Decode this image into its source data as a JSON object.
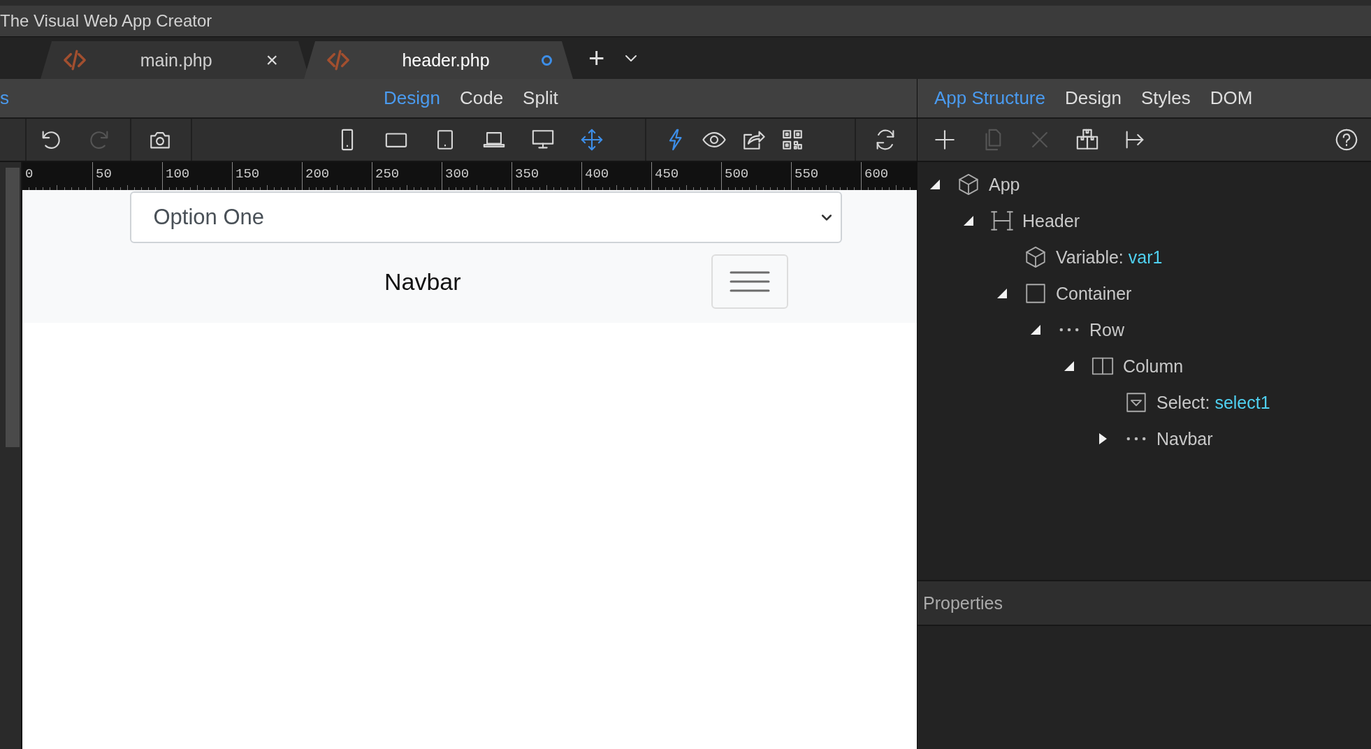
{
  "window": {
    "title": "The Visual Web App Creator"
  },
  "tabs": [
    {
      "label": "main.php",
      "selected": false,
      "close": "×",
      "modified": false
    },
    {
      "label": "header.php",
      "selected": true,
      "modified": true
    }
  ],
  "tab_actions": {
    "add": "+"
  },
  "left_fragment": "s",
  "view_modes": [
    {
      "label": "Design",
      "selected": true
    },
    {
      "label": "Code",
      "selected": false
    },
    {
      "label": "Split",
      "selected": false
    }
  ],
  "panel_tabs": [
    {
      "label": "App Structure",
      "selected": true
    },
    {
      "label": "Design",
      "selected": false
    },
    {
      "label": "Styles",
      "selected": false
    },
    {
      "label": "DOM",
      "selected": false
    }
  ],
  "toolbar": [
    {
      "group": [
        {
          "kind": "undo",
          "disabled": false
        },
        {
          "kind": "redo",
          "disabled": true
        }
      ]
    },
    {
      "group": [
        {
          "kind": "camera",
          "disabled": false
        }
      ]
    },
    {
      "group": [
        {
          "kind": "phone",
          "disabled": false
        },
        {
          "kind": "tablet-landscape",
          "disabled": false
        },
        {
          "kind": "tablet",
          "disabled": false
        },
        {
          "kind": "laptop",
          "disabled": false
        },
        {
          "kind": "desktop",
          "disabled": false
        },
        {
          "kind": "move",
          "disabled": false,
          "active": true
        }
      ]
    },
    {
      "group": [
        {
          "kind": "bolt",
          "disabled": false,
          "active": true
        },
        {
          "kind": "eye",
          "disabled": false
        },
        {
          "kind": "share",
          "disabled": false
        },
        {
          "kind": "qr",
          "disabled": false
        }
      ]
    },
    {
      "group": [
        {
          "kind": "refresh",
          "disabled": false
        }
      ]
    }
  ],
  "panel_toolbar": [
    {
      "kind": "plus",
      "disabled": false
    },
    {
      "kind": "copy",
      "disabled": true
    },
    {
      "kind": "delete",
      "disabled": true
    },
    {
      "kind": "boxes",
      "disabled": false
    },
    {
      "kind": "insert",
      "disabled": false
    }
  ],
  "ruler": {
    "ticks": [
      "0",
      "50",
      "100",
      "150",
      "200",
      "250",
      "300",
      "350",
      "400",
      "450",
      "500",
      "550",
      "600"
    ]
  },
  "canvas": {
    "select": {
      "value": "Option One"
    },
    "navbar": {
      "brand": "Navbar"
    }
  },
  "tree": [
    {
      "kind": "cube",
      "label": "App",
      "expanded": true,
      "children": [
        {
          "kind": "header",
          "label": "Header",
          "expanded": true,
          "children": [
            {
              "kind": "cube",
              "label": "Variable:",
              "value": "var1"
            },
            {
              "kind": "box",
              "label": "Container",
              "expanded": true,
              "children": [
                {
                  "kind": "dots",
                  "label": "Row",
                  "expanded": true,
                  "children": [
                    {
                      "kind": "columns",
                      "label": "Column",
                      "expanded": true,
                      "children": [
                        {
                          "kind": "select",
                          "label": "Select:",
                          "value": "select1"
                        },
                        {
                          "kind": "dots",
                          "label": "Navbar",
                          "expanded": false
                        }
                      ]
                    }
                  ]
                }
              ]
            }
          ]
        }
      ]
    }
  ],
  "properties": {
    "title": "Properties"
  }
}
